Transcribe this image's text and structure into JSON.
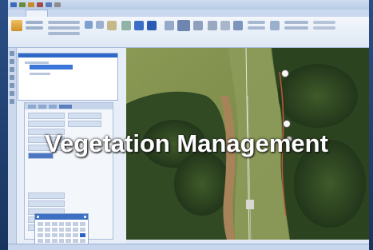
{
  "banner": {
    "title": "Vegetation Management"
  },
  "ribbon": {
    "tabs": [
      "",
      "",
      "",
      ""
    ],
    "groups": [
      "",
      "",
      "",
      ""
    ]
  },
  "map": {
    "markers": [
      "",
      "",
      ""
    ]
  },
  "icons": {
    "quick_access": [
      "save-icon",
      "undo-icon",
      "redo-icon",
      "print-icon",
      "open-icon"
    ],
    "marker": "circle-marker-icon"
  },
  "colors": {
    "window_chrome": "#dfe8f4",
    "selection": "#3a76d8",
    "banner_text": "#ffffff"
  }
}
